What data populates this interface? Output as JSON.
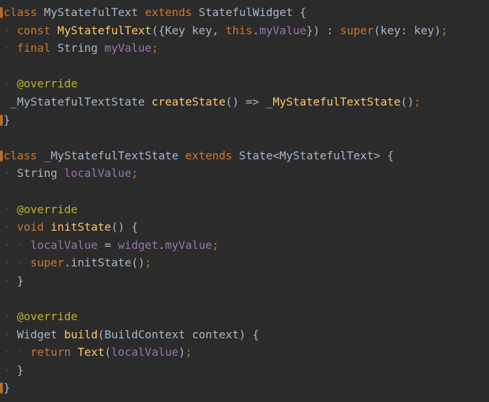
{
  "editor": {
    "lines": [
      {
        "gutter": true,
        "tokens": [
          {
            "t": "class",
            "k": "kw"
          },
          {
            "t": " ",
            "k": "plain"
          },
          {
            "t": "MyStatefulText",
            "k": "type"
          },
          {
            "t": " ",
            "k": "plain"
          },
          {
            "t": "extends",
            "k": "kw"
          },
          {
            "t": " ",
            "k": "plain"
          },
          {
            "t": "StatefulWidget",
            "k": "type"
          },
          {
            "t": " {",
            "k": "plain"
          }
        ]
      },
      {
        "tokens": [
          {
            "t": "· ",
            "k": "guide"
          },
          {
            "t": "const",
            "k": "kw"
          },
          {
            "t": " ",
            "k": "plain"
          },
          {
            "t": "MyStatefulText",
            "k": "fn"
          },
          {
            "t": "({Key key, ",
            "k": "plain"
          },
          {
            "t": "this",
            "k": "kw"
          },
          {
            "t": ".",
            "k": "plain"
          },
          {
            "t": "myValue",
            "k": "field"
          },
          {
            "t": "}) : ",
            "k": "plain"
          },
          {
            "t": "super",
            "k": "kw"
          },
          {
            "t": "(key: key)",
            "k": "plain"
          },
          {
            "t": ";",
            "k": "kw"
          }
        ]
      },
      {
        "tokens": [
          {
            "t": "· ",
            "k": "guide"
          },
          {
            "t": "final",
            "k": "kw"
          },
          {
            "t": " String ",
            "k": "plain"
          },
          {
            "t": "myValue",
            "k": "field"
          },
          {
            "t": ";",
            "k": "kw"
          }
        ]
      },
      {
        "tokens": []
      },
      {
        "tokens": [
          {
            "t": "· ",
            "k": "guide"
          },
          {
            "t": "@override",
            "k": "anno"
          }
        ]
      },
      {
        "tokens": [
          {
            "t": " _MyStatefulTextState ",
            "k": "plain"
          },
          {
            "t": "createState",
            "k": "fn"
          },
          {
            "t": "() => ",
            "k": "plain"
          },
          {
            "t": "_MyStatefulTextState",
            "k": "fn"
          },
          {
            "t": "()",
            "k": "plain"
          },
          {
            "t": ";",
            "k": "kw"
          }
        ]
      },
      {
        "gutter": true,
        "tokens": [
          {
            "t": "}",
            "k": "plain"
          }
        ]
      },
      {
        "tokens": []
      },
      {
        "gutter": true,
        "tokens": [
          {
            "t": "class",
            "k": "kw"
          },
          {
            "t": " _MyStatefulTextState ",
            "k": "plain"
          },
          {
            "t": "extends",
            "k": "kw"
          },
          {
            "t": " State<MyStatefulText> {",
            "k": "plain"
          }
        ]
      },
      {
        "tokens": [
          {
            "t": "· ",
            "k": "guide"
          },
          {
            "t": "String ",
            "k": "plain"
          },
          {
            "t": "localValue",
            "k": "field"
          },
          {
            "t": ";",
            "k": "kw"
          }
        ]
      },
      {
        "tokens": []
      },
      {
        "tokens": [
          {
            "t": "· ",
            "k": "guide"
          },
          {
            "t": "@override",
            "k": "anno"
          }
        ]
      },
      {
        "tokens": [
          {
            "t": "· ",
            "k": "guide"
          },
          {
            "t": "void",
            "k": "kw"
          },
          {
            "t": " ",
            "k": "plain"
          },
          {
            "t": "initState",
            "k": "fn"
          },
          {
            "t": "() {",
            "k": "plain"
          }
        ]
      },
      {
        "tokens": [
          {
            "t": "· · ",
            "k": "guide"
          },
          {
            "t": "localValue",
            "k": "field"
          },
          {
            "t": " = ",
            "k": "plain"
          },
          {
            "t": "widget",
            "k": "field"
          },
          {
            "t": ".",
            "k": "plain"
          },
          {
            "t": "myValue",
            "k": "field"
          },
          {
            "t": ";",
            "k": "kw"
          }
        ]
      },
      {
        "tokens": [
          {
            "t": "· · ",
            "k": "guide"
          },
          {
            "t": "super",
            "k": "kw"
          },
          {
            "t": ".initState()",
            "k": "plain"
          },
          {
            "t": ";",
            "k": "kw"
          }
        ]
      },
      {
        "tokens": [
          {
            "t": "· ",
            "k": "guide"
          },
          {
            "t": "}",
            "k": "plain"
          }
        ]
      },
      {
        "tokens": []
      },
      {
        "tokens": [
          {
            "t": "· ",
            "k": "guide"
          },
          {
            "t": "@override",
            "k": "anno"
          }
        ]
      },
      {
        "tokens": [
          {
            "t": "· ",
            "k": "guide"
          },
          {
            "t": "Widget ",
            "k": "plain"
          },
          {
            "t": "build",
            "k": "fn"
          },
          {
            "t": "(BuildContext context) {",
            "k": "plain"
          }
        ]
      },
      {
        "tokens": [
          {
            "t": "· · ",
            "k": "guide"
          },
          {
            "t": "return",
            "k": "kw"
          },
          {
            "t": " ",
            "k": "plain"
          },
          {
            "t": "Text",
            "k": "fn"
          },
          {
            "t": "(",
            "k": "plain"
          },
          {
            "t": "localValue",
            "k": "field"
          },
          {
            "t": ")",
            "k": "plain"
          },
          {
            "t": ";",
            "k": "kw"
          }
        ]
      },
      {
        "tokens": [
          {
            "t": "· ",
            "k": "guide"
          },
          {
            "t": "}",
            "k": "plain"
          }
        ]
      },
      {
        "gutter": true,
        "tokens": [
          {
            "t": "}",
            "k": "plain"
          }
        ]
      }
    ]
  },
  "colors": {
    "background": "#2b2b2b",
    "keyword": "#cc7832",
    "type": "#a9b7c6",
    "function": "#ffc66d",
    "field": "#9876aa",
    "annotation": "#bbb529",
    "guide": "#4a4a4a"
  }
}
